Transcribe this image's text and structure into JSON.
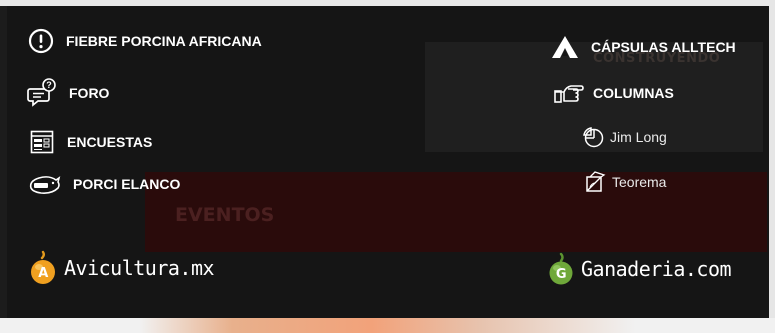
{
  "menu": {
    "left": [
      {
        "label": "FIEBRE PORCINA AFRICANA",
        "icon": "exclamation-circle-icon"
      },
      {
        "label": "FORO",
        "icon": "chat-question-icon"
      },
      {
        "label": "ENCUESTAS",
        "icon": "survey-form-icon"
      },
      {
        "label": "PORCI ELANCO",
        "icon": "pig-badge-icon"
      }
    ],
    "right": [
      {
        "label": "CÁPSULAS ALLTECH",
        "icon": "alltech-logo-icon"
      },
      {
        "label": "COLUMNAS",
        "icon": "pointing-hand-icon"
      }
    ],
    "columns_sub": [
      {
        "label": "Jim Long",
        "icon": "pie-chart-icon"
      },
      {
        "label": "Teorema",
        "icon": "geometry-icon"
      }
    ]
  },
  "brands": {
    "left": {
      "label": "Avicultura.mx",
      "letter": "A",
      "color": "#f0a020"
    },
    "right": {
      "label": "Ganaderia.com",
      "letter": "G",
      "color": "#6fa83a"
    }
  },
  "background": {
    "events_label": "EVENTOS",
    "banner_lines": [
      "CONSTRUYENDO"
    ]
  }
}
